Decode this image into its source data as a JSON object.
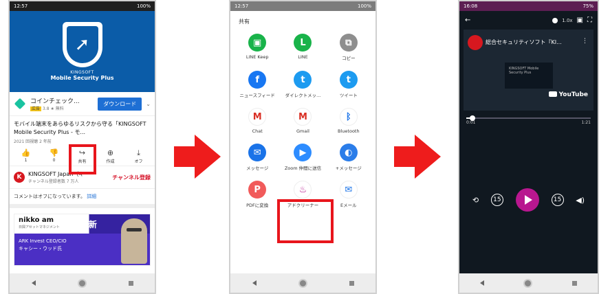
{
  "phone1": {
    "status_time": "12:57",
    "status_right": "100%",
    "hero_brand": "KINGSOFT",
    "hero_title": "Mobile Security Plus",
    "ad": {
      "name": "コインチェック...",
      "badge": "広告",
      "meta": "3.8 ★ 無料",
      "download_label": "ダウンロード"
    },
    "video_title": "モバイル端末をあらゆるリスクから守る「KINGSOFT Mobile Security Plus - モ...",
    "video_meta": "2021 回視聴 2 年前",
    "actions": [
      {
        "icon": "👍",
        "label": "1"
      },
      {
        "icon": "👎",
        "label": "0"
      },
      {
        "icon": "↪",
        "label": "共有"
      },
      {
        "icon": "⊕",
        "label": "作成"
      },
      {
        "icon": "⤓",
        "label": "オフ"
      }
    ],
    "channel_name": "KINGSOFT Japan（キー",
    "channel_subs": "チャンネル登録者数 7 万人",
    "subscribe_label": "チャンネル登録",
    "comments_off": "コメントはオフになっています。",
    "comments_link": "詳細",
    "banner": {
      "logo": "nikko am",
      "logo_sub": "日興アセットマネジメント",
      "update": "毎月更新",
      "line1": "ARK Invest CEO/CIO",
      "line2": "キャシー・ウッド氏"
    }
  },
  "phone2": {
    "status_time": "12:57",
    "status_right": "100%",
    "share_title": "共有",
    "apps": [
      {
        "label": "LINE Keep",
        "icon": "▣",
        "color": "#19b34a"
      },
      {
        "label": "LINE",
        "icon": "L",
        "color": "#19b34a"
      },
      {
        "label": "コピー",
        "icon": "⧉",
        "color": "#8e8e8e"
      },
      {
        "label": "ニュースフィード",
        "icon": "f",
        "color": "#1877f2"
      },
      {
        "label": "ダイレクトメッ...",
        "icon": "t",
        "color": "#1d9bf0"
      },
      {
        "label": "ツイート",
        "icon": "t",
        "color": "#1d9bf0"
      },
      {
        "label": "Chat",
        "icon": "M",
        "color": "#ffffff"
      },
      {
        "label": "Gmail",
        "icon": "M",
        "color": "#ffffff"
      },
      {
        "label": "Bluetooth",
        "icon": "ᛒ",
        "color": "#ffffff"
      },
      {
        "label": "メッセージ",
        "icon": "✉",
        "color": "#1a73e8"
      },
      {
        "label": "Zoom 仲間に送信",
        "icon": "▶",
        "color": "#2d8cff"
      },
      {
        "label": "+メッセージ",
        "icon": "◐",
        "color": "#2b7de9"
      },
      {
        "label": "PDFに変換",
        "icon": "P",
        "color": "#f15b5b"
      },
      {
        "label": "アドクリーナー",
        "icon": "♨",
        "color": "#ffffff"
      },
      {
        "label": "Eメール",
        "icon": "✉",
        "color": "#ffffff"
      }
    ]
  },
  "phone3": {
    "status_time": "16:08",
    "status_right": "75%",
    "speed": "1.0x",
    "video_title": "総合セキュリティソフト『KI...",
    "inner_text": "KINGSOFT Mobile Security Plus",
    "youtube_label": "YouTube",
    "time_current": "0:01",
    "time_total": "1:21",
    "progress": 0.04,
    "skip_back": "15",
    "skip_fwd": "15"
  },
  "colors": {
    "highlight": "#e8151c",
    "arrow": "#ee1c1c",
    "play": "#b8178f"
  }
}
